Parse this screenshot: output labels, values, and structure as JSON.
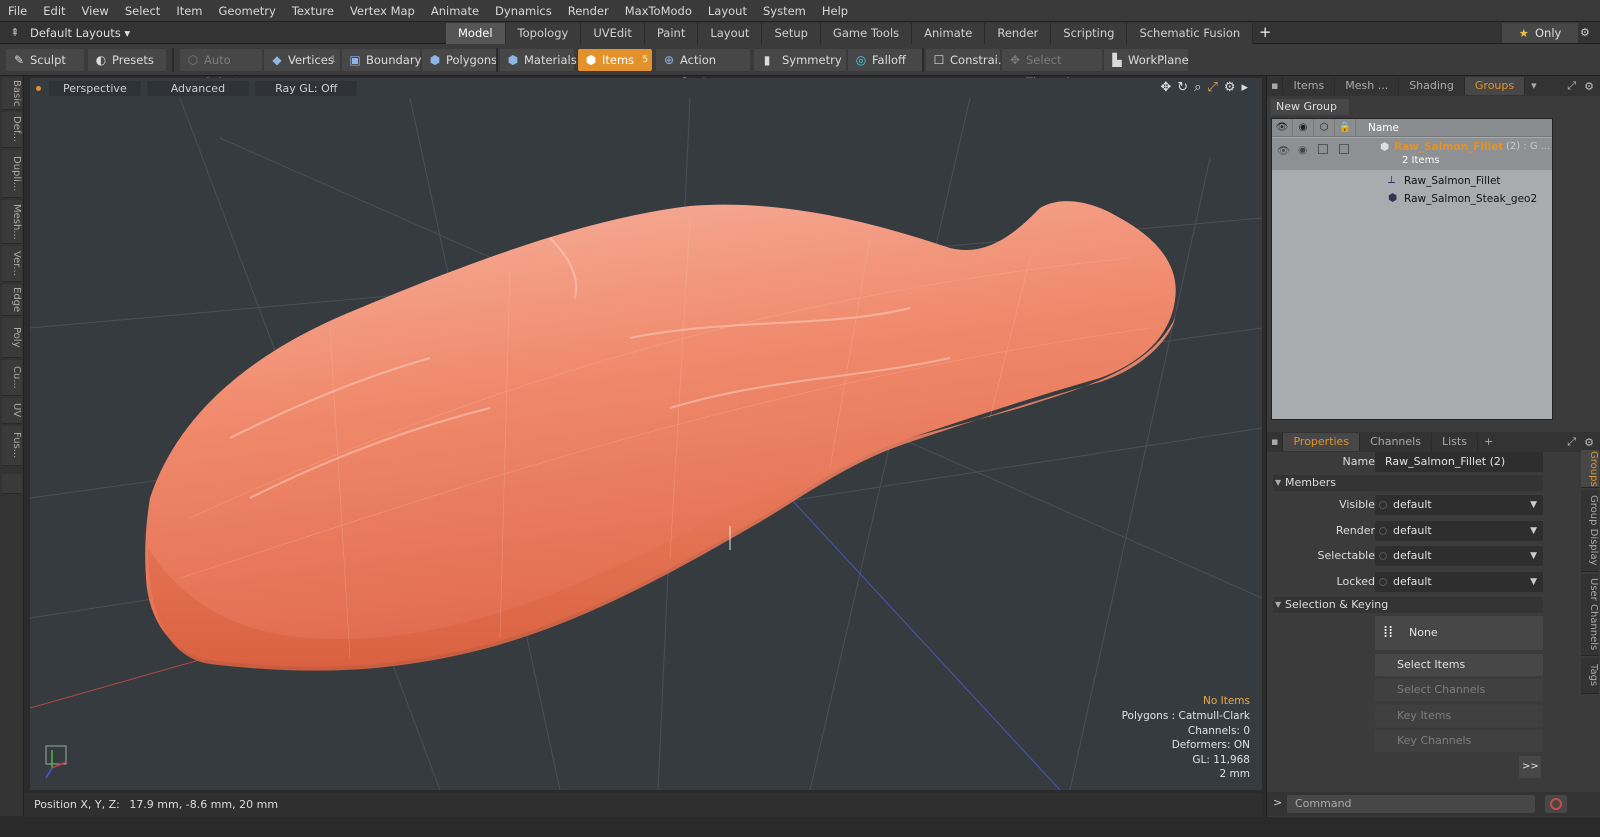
{
  "menubar": [
    "File",
    "Edit",
    "View",
    "Select",
    "Item",
    "Geometry",
    "Texture",
    "Vertex Map",
    "Animate",
    "Dynamics",
    "Render",
    "MaxToModo",
    "Layout",
    "System",
    "Help"
  ],
  "layoutbar": {
    "layout_dropdown": "Default Layouts",
    "tabs": [
      "Model",
      "Topology",
      "UVEdit",
      "Paint",
      "Layout",
      "Setup",
      "Game Tools",
      "Animate",
      "Render",
      "Scripting",
      "Schematic Fusion"
    ],
    "active_tab": "Model",
    "only_label": "Only"
  },
  "toolbar": {
    "sculpt": "Sculpt",
    "presets": "Presets",
    "auto_select": "Auto Select",
    "vertices": "Vertices",
    "vertices_count": "1",
    "boundary": "Boundary",
    "polygons": "Polygons",
    "materials": "Materials",
    "items": "Items",
    "items_count": "5",
    "action_center": "Action Center",
    "symmetry": "Symmetry",
    "falloff": "Falloff",
    "constraints": "Constrai...",
    "select_through": "Select Through",
    "workplane": "WorkPlane"
  },
  "leftstrip": [
    "Basic",
    "Def...",
    "Dupli...",
    "Mesh...",
    "Ver...",
    "Edge",
    "Poly",
    "Cu...",
    "UV",
    "Fus..."
  ],
  "viewport": {
    "perspective": "Perspective",
    "advanced": "Advanced",
    "raygl": "Ray GL: Off",
    "info": {
      "no_items": "No Items",
      "polygons": "Polygons : Catmull-Clark",
      "channels": "Channels: 0",
      "deformers": "Deformers: ON",
      "gl": "GL: 11,968",
      "scale": "2 mm"
    },
    "colors": {
      "background": "#363b40",
      "salmon": "#f28a6e",
      "salmon_dark": "#e0694c"
    }
  },
  "statusbar": {
    "position_label": "Position X, Y, Z:",
    "position_value": "17.9 mm, -8.6 mm, 20 mm"
  },
  "groups_panel": {
    "tabs": [
      "Items",
      "Mesh ...",
      "Shading",
      "Groups"
    ],
    "active_tab": "Groups",
    "new_group": "New Group",
    "name_header": "Name",
    "group_name": "Raw_Salmon_Fillet",
    "group_suffix": "(2) : G ...",
    "group_count": "2 Items",
    "children": [
      "Raw_Salmon_Fillet",
      "Raw_Salmon_Steak_geo2"
    ]
  },
  "properties_panel": {
    "tabs": [
      "Properties",
      "Channels",
      "Lists"
    ],
    "active_tab": "Properties",
    "name_label": "Name",
    "name_value": "Raw_Salmon_Fillet (2)",
    "members_section": "Members",
    "visible_label": "Visible",
    "visible_value": "default",
    "render_label": "Render",
    "render_value": "default",
    "selectable_label": "Selectable",
    "selectable_value": "default",
    "locked_label": "Locked",
    "locked_value": "default",
    "selection_section": "Selection & Keying",
    "none_button": "None",
    "select_items": "Select Items",
    "select_channels": "Select Channels",
    "key_items": "Key Items",
    "key_channels": "Key Channels",
    "more": ">>",
    "side_tabs": [
      "Groups",
      "Group Display",
      "User Channels",
      "Tags"
    ]
  },
  "command": {
    "placeholder": "Command",
    "prompt": ">"
  }
}
